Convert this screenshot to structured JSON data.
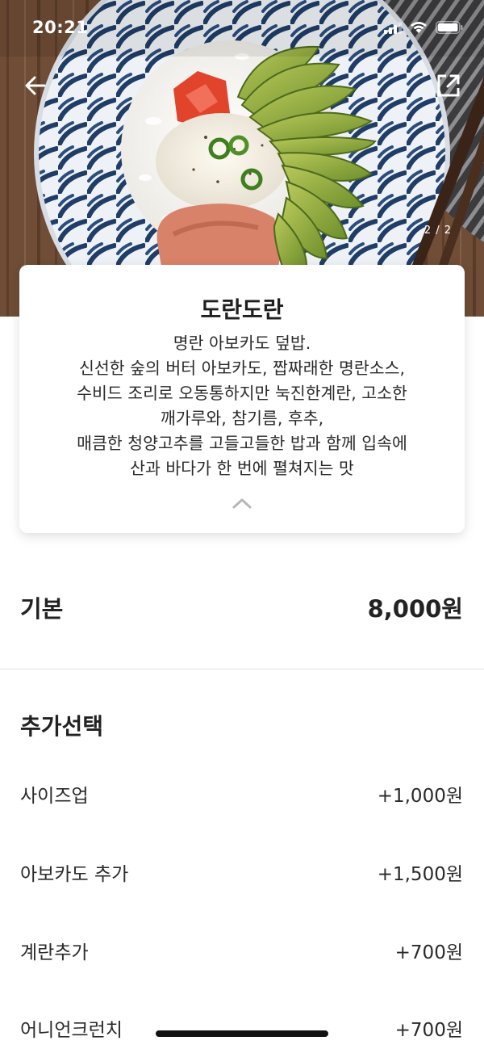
{
  "status_bar": {
    "time": "20:21"
  },
  "hero": {
    "page_counter": "2 / 2"
  },
  "card": {
    "title": "도란도란",
    "description": "명란 아보카도 덮밥.\n신선한 숲의 버터 아보카도, 짭짜래한 명란소스,\n수비드 조리로 오동통하지만 눅진한계란, 고소한\n깨가루와, 참기름, 후추,\n매큼한 청양고추를 고들고들한 밥과 함께 입속에\n산과 바다가 한 번에 펼쳐지는 맛"
  },
  "base": {
    "label": "기본",
    "price": "8,000원"
  },
  "options": {
    "title": "추가선택",
    "items": [
      {
        "name": "사이즈업",
        "price": "+1,000원"
      },
      {
        "name": "아보카도 추가",
        "price": "+1,500원"
      },
      {
        "name": "계란추가",
        "price": "+700원"
      },
      {
        "name": "어니언크런치",
        "price": "+700원"
      }
    ]
  },
  "icons": {
    "back": "arrow-left-icon",
    "share": "share-external-icon",
    "collapse": "chevron-up-icon"
  }
}
